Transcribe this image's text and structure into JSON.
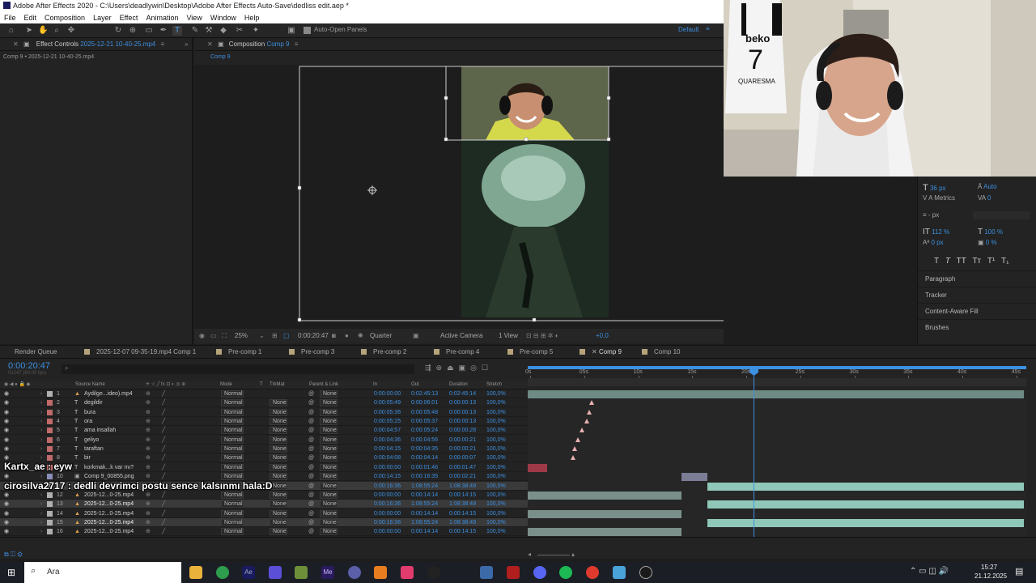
{
  "window": {
    "title": "Adobe After Effects 2020 - C:\\Users\\deadlywin\\Desktop\\Adobe After Effects Auto-Save\\dedliss edit.aep *"
  },
  "menu": [
    "File",
    "Edit",
    "Composition",
    "Layer",
    "Effect",
    "Animation",
    "View",
    "Window",
    "Help"
  ],
  "toolbar": {
    "auto_open": "Auto-Open Panels",
    "workspace": "Default"
  },
  "effect_controls": {
    "title": "Effect Controls",
    "file": "2025-12-21 10-40-25.mp4",
    "subtitle": "Comp 9 • 2025-12-21 10-40-25.mp4"
  },
  "composition": {
    "title": "Composition",
    "name": "Comp 9",
    "tab": "Comp 9"
  },
  "viewer_bar": {
    "zoom": "25%",
    "timecode": "0:00:20:47",
    "resolution": "Quarter",
    "camera": "Active Camera",
    "views": "1 View",
    "exposure": "+0,0"
  },
  "character": {
    "size": "36 px",
    "leading": "Auto",
    "kerning": "Metrics",
    "tracking": "0",
    "stroke": "- px",
    "vscale": "112 %",
    "hscale": "100 %",
    "baseline": "0 px",
    "tsume": "0 %",
    "styles": [
      "T",
      "T",
      "TT",
      "Tт",
      "T¹",
      "T₁"
    ]
  },
  "right_sections": [
    "Paragraph",
    "Tracker",
    "Content-Aware Fill",
    "Brushes"
  ],
  "tabs": [
    {
      "label": "Render Queue",
      "color": ""
    },
    {
      "label": "2025-12-07 09-35-19.mp4 Comp 1",
      "color": "#b5a37a"
    },
    {
      "label": "Pre-comp 1",
      "color": "#b5a37a"
    },
    {
      "label": "Pre-comp 3",
      "color": "#b5a37a"
    },
    {
      "label": "Pre-comp 2",
      "color": "#b5a37a"
    },
    {
      "label": "Pre-comp 4",
      "color": "#b5a37a"
    },
    {
      "label": "Pre-comp 5",
      "color": "#b5a37a"
    },
    {
      "label": "Comp 9",
      "color": "#b5a37a",
      "active": true
    },
    {
      "label": "Comp 10",
      "color": "#b5a37a"
    }
  ],
  "timeline": {
    "timecode": "0:00:20:47",
    "fps": "01247 (60.00 fps)",
    "columns": [
      "Source Name",
      "Mode",
      "T",
      "TrkMat",
      "Parent & Link",
      "In",
      "Out",
      "Duration",
      "Stretch"
    ],
    "ruler": [
      "0s",
      "05s",
      "10s",
      "15s",
      "20s",
      "25s",
      "30s",
      "35s",
      "40s",
      "45s"
    ],
    "layers": [
      {
        "n": "1",
        "name": "Aydilge...ideo).mp4",
        "mode": "Normal",
        "trk": "",
        "parent": "None",
        "in": "0:00:00:00",
        "out": "0:02:45:13",
        "dur": "0:02:45:14",
        "str": "100,0%",
        "icon": "film"
      },
      {
        "n": "2",
        "name": "degildir",
        "mode": "Normal",
        "trk": "None",
        "parent": "None",
        "in": "0:00:05:49",
        "out": "0:00:06:01",
        "dur": "0:00:00:13",
        "str": "100,0%",
        "icon": "T"
      },
      {
        "n": "3",
        "name": "bura",
        "mode": "Normal",
        "trk": "None",
        "parent": "None",
        "in": "0:00:05:36",
        "out": "0:00:05:48",
        "dur": "0:00:00:13",
        "str": "100,0%",
        "icon": "T"
      },
      {
        "n": "4",
        "name": "ora",
        "mode": "Normal",
        "trk": "None",
        "parent": "None",
        "in": "0:00:05:25",
        "out": "0:00:05:37",
        "dur": "0:00:00:13",
        "str": "100,0%",
        "icon": "T"
      },
      {
        "n": "5",
        "name": "ama insallah",
        "mode": "Normal",
        "trk": "None",
        "parent": "None",
        "in": "0:00:04:57",
        "out": "0:00:05:24",
        "dur": "0:00:00:28",
        "str": "100,0%",
        "icon": "T"
      },
      {
        "n": "6",
        "name": "geliyo",
        "mode": "Normal",
        "trk": "None",
        "parent": "None",
        "in": "0:00:04:36",
        "out": "0:00:04:56",
        "dur": "0:00:00:21",
        "str": "100,0%",
        "icon": "T"
      },
      {
        "n": "7",
        "name": "taraftan",
        "mode": "Normal",
        "trk": "None",
        "parent": "None",
        "in": "0:00:04:15",
        "out": "0:00:04:35",
        "dur": "0:00:00:21",
        "str": "100,0%",
        "icon": "T"
      },
      {
        "n": "8",
        "name": "bir",
        "mode": "Normal",
        "trk": "None",
        "parent": "None",
        "in": "0:00:04:08",
        "out": "0:00:04:14",
        "dur": "0:00:00:07",
        "str": "100,0%",
        "icon": "T"
      },
      {
        "n": "9",
        "name": "korkmak...k var mı?",
        "mode": "Normal",
        "trk": "None",
        "parent": "None",
        "in": "0:00:00:00",
        "out": "0:00:01:46",
        "dur": "0:00:01:47",
        "str": "100,0%",
        "icon": "T"
      },
      {
        "n": "10",
        "name": "Comp 9_00855.png",
        "mode": "Normal",
        "trk": "None",
        "parent": "None",
        "in": "0:00:14:15",
        "out": "0:00:16:35",
        "dur": "0:00:02:21",
        "str": "100,0%",
        "icon": "img"
      },
      {
        "n": "11",
        "name": "",
        "mode": "",
        "trk": "None",
        "parent": "None",
        "in": "0:00:16:36",
        "out": "1:08:55:24",
        "dur": "1:08:38:49",
        "str": "100,0%",
        "icon": "film"
      },
      {
        "n": "12",
        "name": "2025-12...0-25.mp4",
        "mode": "Normal",
        "trk": "None",
        "parent": "None",
        "in": "0:00:00:00",
        "out": "0:00:14:14",
        "dur": "0:00:14:15",
        "str": "100,0%",
        "icon": "film"
      },
      {
        "n": "13",
        "name": "2025-12...0-25.mp4",
        "mode": "Normal",
        "trk": "None",
        "parent": "None",
        "in": "0:00:16:36",
        "out": "1:08:55:24",
        "dur": "1:08:38:49",
        "str": "100,0%",
        "icon": "film"
      },
      {
        "n": "14",
        "name": "2025-12...0-25.mp4",
        "mode": "Normal",
        "trk": "None",
        "parent": "None",
        "in": "0:00:00:00",
        "out": "0:00:14:14",
        "dur": "0:00:14:15",
        "str": "100,0%",
        "icon": "film"
      },
      {
        "n": "15",
        "name": "2025-12...0-25.mp4",
        "mode": "Normal",
        "trk": "None",
        "parent": "None",
        "in": "0:00:16:36",
        "out": "1:08:55:24",
        "dur": "1:08:38:49",
        "str": "100,0%",
        "icon": "film"
      },
      {
        "n": "16",
        "name": "2025-12...0-25.mp4",
        "mode": "Normal",
        "trk": "None",
        "parent": "None",
        "in": "0:00:00:00",
        "out": "0:00:14:14",
        "dur": "0:00:14:15",
        "str": "100,0%",
        "icon": "film"
      }
    ]
  },
  "chat": {
    "line1": "Kartx_ae : eyw",
    "line2": "cirosilva2717 : dedli devrimci postu sence kalsınmı hala:D"
  },
  "taskbar": {
    "search": "Ara",
    "time": "15:27",
    "date": "21.12.2025"
  },
  "webcam": {
    "jersey_brand": "beko",
    "jersey_number": "7",
    "jersey_name": "QUARESMA"
  }
}
